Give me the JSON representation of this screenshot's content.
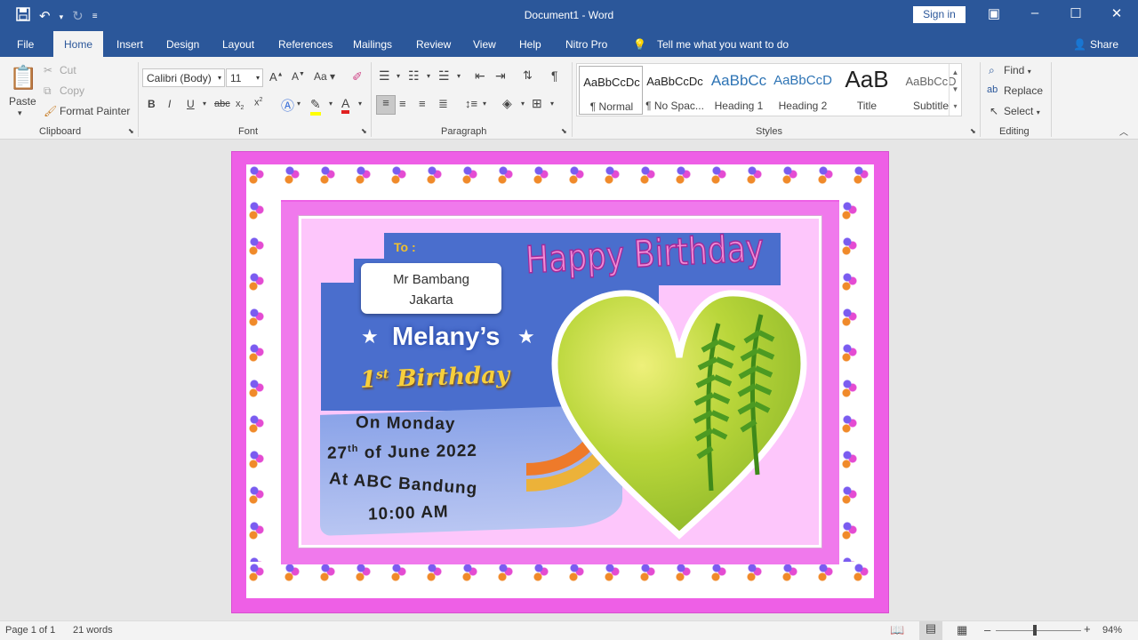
{
  "window": {
    "title": "Document1 - Word",
    "sign_in": "Sign in"
  },
  "tabs": [
    "File",
    "Home",
    "Insert",
    "Design",
    "Layout",
    "References",
    "Mailings",
    "Review",
    "View",
    "Help",
    "Nitro Pro"
  ],
  "tell_me": "Tell me what you want to do",
  "share": "Share",
  "clipboard": {
    "paste": "Paste",
    "cut": "Cut",
    "copy": "Copy",
    "format_painter": "Format Painter",
    "group": "Clipboard"
  },
  "font": {
    "name": "Calibri (Body)",
    "size": "11",
    "group": "Font",
    "change_case": "Aa"
  },
  "paragraph": {
    "group": "Paragraph"
  },
  "styles": {
    "group": "Styles",
    "items": [
      {
        "sample": "AaBbCcDc",
        "label": "¶ Normal"
      },
      {
        "sample": "AaBbCcDc",
        "label": "¶ No Spac..."
      },
      {
        "sample": "AaBbCc",
        "label": "Heading 1"
      },
      {
        "sample": "AaBbCcD",
        "label": "Heading 2"
      },
      {
        "sample": "AaB",
        "label": "Title"
      },
      {
        "sample": "AaBbCcD",
        "label": "Subtitle"
      }
    ]
  },
  "editing": {
    "find": "Find",
    "replace": "Replace",
    "select": "Select",
    "group": "Editing"
  },
  "card": {
    "to_label": "To :",
    "recipient_name": "Mr Bambang",
    "recipient_city": "Jakarta",
    "happy": "Happy Birthday",
    "name": "Melany’s",
    "age_num": "1",
    "age_sup": "st",
    "birthday": "Birthday",
    "line1": "On Monday",
    "line2_day": "27",
    "line2_sup": "th",
    "line2_rest": "of June 2022",
    "line3": "At ABC Bandung",
    "line4": "10:00 AM"
  },
  "status": {
    "page": "Page 1 of 1",
    "words": "21 words",
    "zoom": "94%"
  },
  "colors": {
    "word_blue": "#2b579a",
    "page_pink": "#ee5fe6",
    "card_pink": "#fdc6fb",
    "card_blue": "#4a6ecd"
  }
}
